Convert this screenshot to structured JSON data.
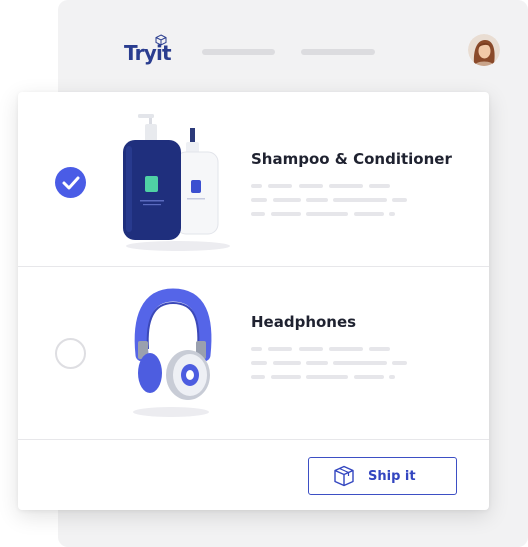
{
  "app": {
    "logo_text": "Tryit",
    "colors": {
      "accent": "#4a5ce6",
      "brand": "#2a3d8f",
      "background": "#f2f2f3"
    }
  },
  "header": {
    "nav_placeholders": 2,
    "avatar": "user-avatar"
  },
  "products": [
    {
      "name": "Shampoo & Conditioner",
      "selected": true,
      "image": "shampoo-conditioner-bottles"
    },
    {
      "name": "Headphones",
      "selected": false,
      "image": "headphones"
    }
  ],
  "footer": {
    "ship_label": "Ship it",
    "ship_icon": "box-icon"
  }
}
